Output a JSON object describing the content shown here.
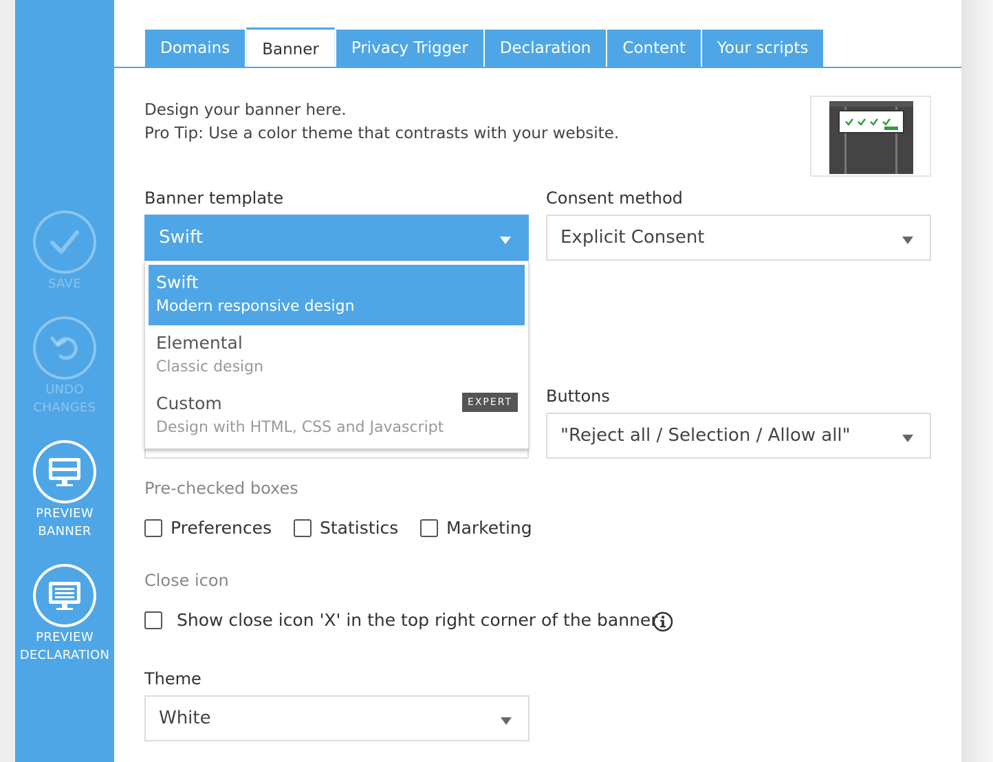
{
  "sidebar": {
    "save_label": "SAVE",
    "undo_label_line1": "UNDO",
    "undo_label_line2": "CHANGES",
    "preview_banner_line1": "PREVIEW",
    "preview_banner_line2": "BANNER",
    "preview_declaration_line1": "PREVIEW",
    "preview_declaration_line2": "DECLARATION",
    "accent_color": "#4ea6e6"
  },
  "tabs": [
    {
      "label": "Domains",
      "active": false
    },
    {
      "label": "Banner",
      "active": true
    },
    {
      "label": "Privacy Trigger",
      "active": false
    },
    {
      "label": "Declaration",
      "active": false
    },
    {
      "label": "Content",
      "active": false
    },
    {
      "label": "Your scripts",
      "active": false
    }
  ],
  "intro": {
    "line1": "Design your banner here.",
    "line2": "Pro Tip: Use a color theme that contrasts with your website."
  },
  "banner_template": {
    "label": "Banner template",
    "value": "Swift",
    "options": [
      {
        "title": "Swift",
        "subtitle": "Modern responsive design",
        "selected": true
      },
      {
        "title": "Elemental",
        "subtitle": "Classic design",
        "selected": false
      },
      {
        "title": "Custom",
        "subtitle": "Design with HTML, CSS and Javascript",
        "badge": "EXPERT",
        "selected": false
      }
    ]
  },
  "consent_method": {
    "label": "Consent method",
    "value": "Explicit Consent"
  },
  "buttons": {
    "label": "Buttons",
    "value": "\"Reject all / Selection / Allow all\""
  },
  "prechecked": {
    "label": "Pre-checked boxes",
    "items": [
      {
        "label": "Preferences",
        "checked": false
      },
      {
        "label": "Statistics",
        "checked": false
      },
      {
        "label": "Marketing",
        "checked": false
      }
    ]
  },
  "close_icon": {
    "label": "Close icon",
    "checkbox_label": "Show close icon 'X' in the top right corner of the banner",
    "checked": false
  },
  "theme": {
    "label": "Theme",
    "value": "White"
  },
  "icons": {
    "save": "checkmark-icon",
    "undo": "undo-icon",
    "preview_banner": "monitor-banner-icon",
    "preview_declaration": "monitor-text-icon",
    "info": "info-icon"
  }
}
